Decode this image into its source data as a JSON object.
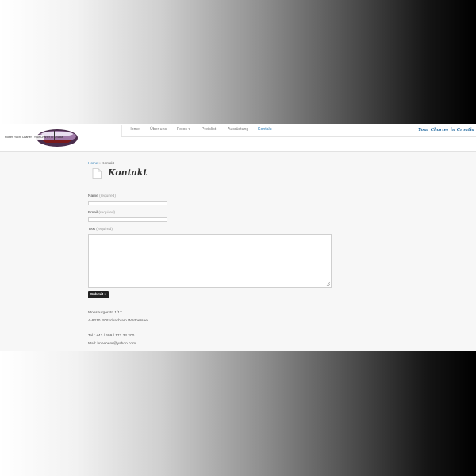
{
  "header": {
    "logo_text": "Flotten Yacht Charter | Your Charter in Croatia",
    "tagline": "Your Charter in Croatia"
  },
  "nav": {
    "items": [
      {
        "label": "Home"
      },
      {
        "label": "Über uns"
      },
      {
        "label": "Fotos ▾"
      },
      {
        "label": "Preislist"
      },
      {
        "label": "Ausrüstung"
      },
      {
        "label": "Kontakt"
      }
    ]
  },
  "breadcrumb": {
    "home": "Home",
    "separator": " » ",
    "current": "Kontakt"
  },
  "page": {
    "title": "Kontakt"
  },
  "form": {
    "name_label": "Name",
    "email_label": "Email",
    "text_label": "Text",
    "required": "(required)",
    "submit_label": "Submit »"
  },
  "contact": {
    "line1": "Moosburgerstr. 1/17",
    "line2": "A-9210 Pörtschach am Wörthersee",
    "phone": "Tel.: +43 / 699 / 171 33 200",
    "mail": "Mail: bnbebenr@yahoo.com"
  },
  "colors": {
    "accent": "#2f7fb8",
    "button": "#222222",
    "page_bg": "#f7f7f7"
  }
}
